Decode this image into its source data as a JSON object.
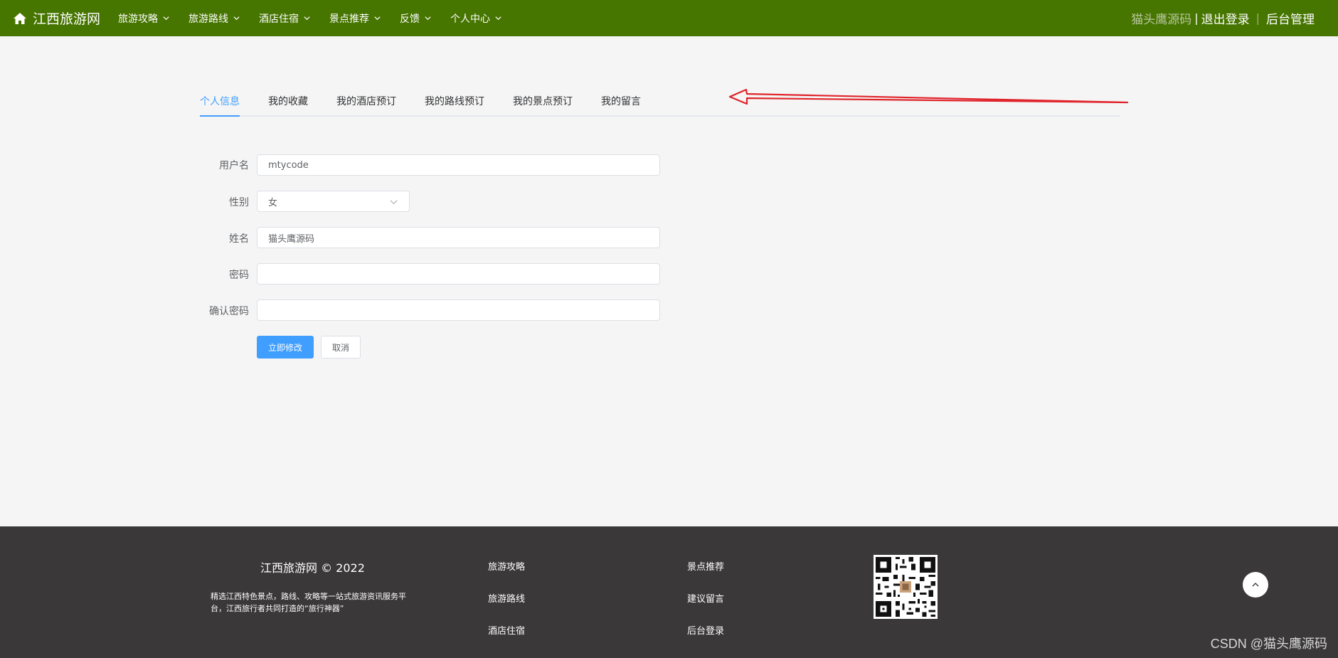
{
  "header": {
    "brand": "江西旅游网",
    "nav": [
      "旅游攻略",
      "旅游路线",
      "酒店住宿",
      "景点推荐",
      "反馈",
      "个人中心"
    ],
    "user": "猫头鹰源码",
    "sep1": "|",
    "logout": "退出登录",
    "sep2": "|",
    "admin": "后台管理"
  },
  "tabs": [
    "个人信息",
    "我的收藏",
    "我的酒店预订",
    "我的路线预订",
    "我的景点预订",
    "我的留言"
  ],
  "form": {
    "username_label": "用户名",
    "username_value": "mtycode",
    "gender_label": "性别",
    "gender_value": "女",
    "name_label": "姓名",
    "name_value": "猫头鹰源码",
    "password_label": "密码",
    "password_value": "",
    "confirm_label": "确认密码",
    "confirm_value": "",
    "submit": "立即修改",
    "cancel": "取消"
  },
  "footer": {
    "copyright": "江西旅游网 © 2022",
    "description": "精选江西特色景点，路线、攻略等一站式旅游资讯服务平台，江西旅行者共同打造的“旅行神器”",
    "links_col1": [
      "旅游攻略",
      "旅游路线",
      "酒店住宿"
    ],
    "links_col2": [
      "景点推荐",
      "建议留言",
      "后台登录"
    ]
  },
  "watermark": "CSDN @猫头鹰源码",
  "colors": {
    "topbar": "#467500",
    "accent": "#409eff",
    "footer": "#3a3838",
    "annotation": "#e0242b"
  }
}
